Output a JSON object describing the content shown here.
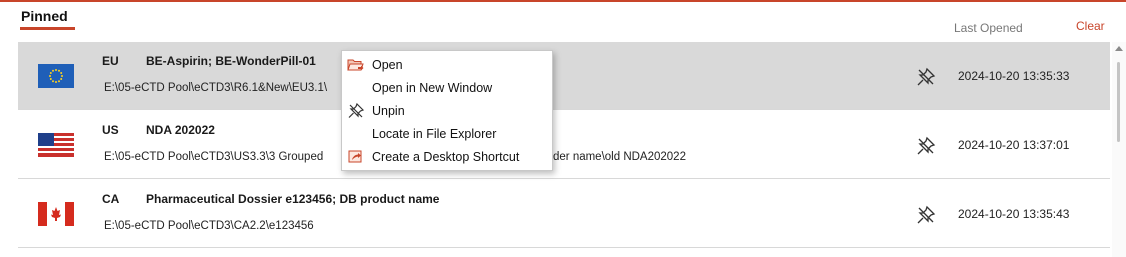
{
  "tabs": {
    "pinned": "Pinned"
  },
  "header": {
    "last_opened": "Last Opened",
    "clear": "Clear"
  },
  "rows": [
    {
      "flag_icon": "eu-flag-icon",
      "region": "EU",
      "title": "BE-Aspirin; BE-WonderPill-01",
      "path": "E:\\05-eCTD Pool\\eCTD3\\R6.1&New\\EU3.1\\",
      "date": "2024-10-20 13:35:33",
      "selected": true
    },
    {
      "flag_icon": "us-flag-icon",
      "region": "US",
      "title": "NDA 202022",
      "path": "E:\\05-eCTD Pool\\eCTD3\\US3.3\\3 Grouped",
      "path_suffix": "der name\\old NDA202022",
      "date": "2024-10-20 13:37:01",
      "selected": false
    },
    {
      "flag_icon": "ca-flag-icon",
      "region": "CA",
      "title": "Pharmaceutical Dossier e123456; DB product name",
      "path": "E:\\05-eCTD Pool\\eCTD3\\CA2.2\\e123456",
      "date": "2024-10-20 13:35:43",
      "selected": false
    }
  ],
  "context_menu": {
    "items": [
      {
        "label": "Open",
        "icon": "open-folder-icon"
      },
      {
        "label": "Open in New Window",
        "icon": ""
      },
      {
        "label": "Unpin",
        "icon": "unpin-icon"
      },
      {
        "label": "Locate in File Explorer",
        "icon": ""
      },
      {
        "label": "Create a Desktop Shortcut",
        "icon": "shortcut-icon"
      }
    ]
  },
  "colors": {
    "accent": "#c8452a",
    "selected_row": "#d9d9d9"
  }
}
